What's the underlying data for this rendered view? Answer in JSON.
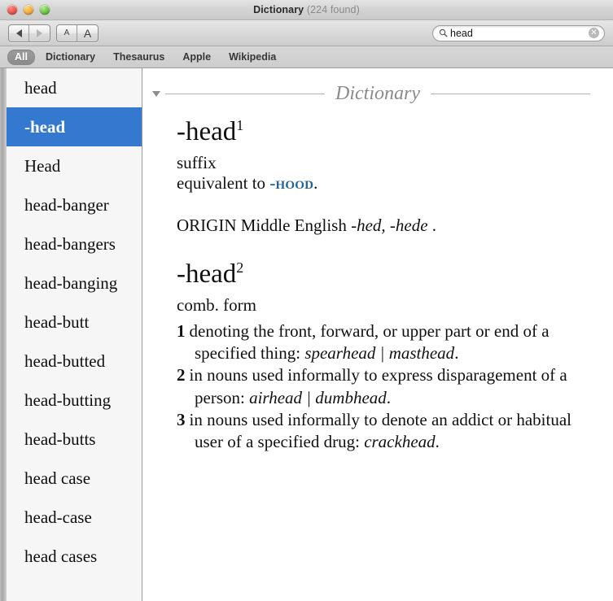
{
  "window": {
    "title_app": "Dictionary",
    "title_count": "(224 found)"
  },
  "toolbar": {
    "back_label": "Back",
    "forward_label": "Forward",
    "font_smaller_label": "A",
    "font_larger_label": "A",
    "search": {
      "value": "head",
      "placeholder": "Search",
      "icon": "search-icon",
      "clear_icon": "✕"
    }
  },
  "sources": {
    "tabs": [
      {
        "label": "All",
        "selected": true
      },
      {
        "label": "Dictionary",
        "selected": false
      },
      {
        "label": "Thesaurus",
        "selected": false
      },
      {
        "label": "Apple",
        "selected": false
      },
      {
        "label": "Wikipedia",
        "selected": false
      }
    ]
  },
  "sidebar": {
    "items": [
      {
        "label": "head",
        "selected": false
      },
      {
        "label": "-head",
        "selected": true
      },
      {
        "label": "Head",
        "selected": false
      },
      {
        "label": "head-banger",
        "selected": false
      },
      {
        "label": "head-bangers",
        "selected": false
      },
      {
        "label": "head-banging",
        "selected": false
      },
      {
        "label": "head-butt",
        "selected": false
      },
      {
        "label": "head-butted",
        "selected": false
      },
      {
        "label": "head-butting",
        "selected": false
      },
      {
        "label": "head-butts",
        "selected": false
      },
      {
        "label": "head case",
        "selected": false
      },
      {
        "label": "head-case",
        "selected": false
      },
      {
        "label": "head cases",
        "selected": false
      }
    ]
  },
  "definition": {
    "section_title": "Dictionary",
    "entry1": {
      "headword": "-head",
      "homograph": "1",
      "part_of_speech": "suffix",
      "equivalent_prefix": "equivalent to ",
      "equivalent_xref": "-hood",
      "equivalent_suffix": ".",
      "origin_label": "ORIGIN",
      "origin_text": " Middle English ",
      "origin_forms": "-hed, -hede",
      "origin_end": " ."
    },
    "entry2": {
      "headword": "-head",
      "homograph": "2",
      "part_of_speech": "comb. form",
      "senses": [
        {
          "num": "1",
          "text": "denoting the front, forward, or upper part or end of a specified thing: ",
          "examples": "spearhead | masthead",
          "end": "."
        },
        {
          "num": "2",
          "text": "in nouns used informally to express disparagement of a person: ",
          "examples": "airhead | dumbhead",
          "end": "."
        },
        {
          "num": "3",
          "text": "in nouns used informally to denote an addict or habitual user of a specified drug: ",
          "examples": "crackhead",
          "end": "."
        }
      ]
    }
  }
}
